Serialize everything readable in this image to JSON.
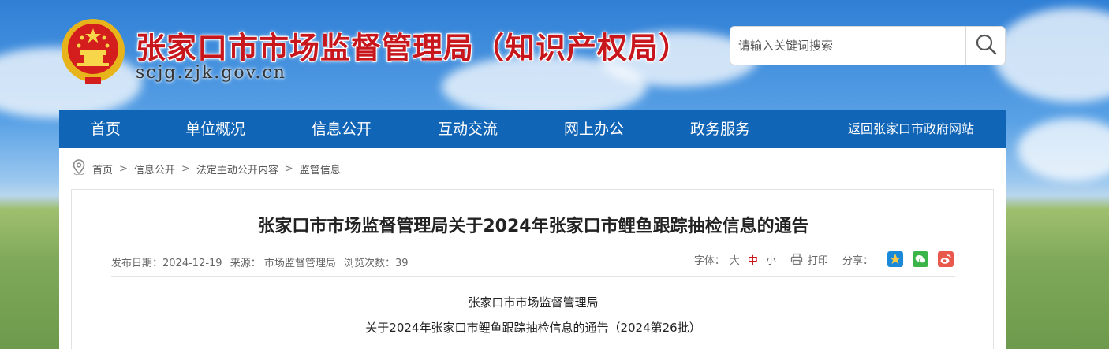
{
  "header": {
    "site_title": "张家口市市场监督管理局（知识产权局）",
    "site_domain": "scjg.zjk.gov.cn",
    "search_placeholder": "请输入关键词搜索"
  },
  "nav": {
    "items": [
      "首页",
      "单位概况",
      "信息公开",
      "互动交流",
      "网上办公",
      "政务服务"
    ],
    "back_link": "返回张家口市政府网站"
  },
  "breadcrumb": [
    "首页",
    "信息公开",
    "法定主动公开内容",
    "监管信息"
  ],
  "breadcrumb_sep": ">",
  "article": {
    "title": "张家口市市场监督管理局关于2024年张家口市鲤鱼跟踪抽检信息的通告",
    "meta": {
      "date": "发布日期：2024-12-19",
      "source": "来源： 市场监督管理局",
      "views": "浏览次数：39"
    },
    "tools": {
      "font_label": "字体：",
      "font_large": "大",
      "font_medium": "中",
      "font_small": "小",
      "print": "打印",
      "share_label": "分享："
    },
    "body": [
      "张家口市市场监督管理局",
      "关于2024年张家口市鲤鱼跟踪抽检信息的通告（2024第26批）"
    ]
  },
  "colors": {
    "brand_red": "#c8161d",
    "nav_blue": "#1165b6",
    "qzone": "#1a8ad8",
    "wechat": "#3bb44a",
    "weibo": "#e8584b"
  },
  "icons": [
    "emblem-icon",
    "search-icon",
    "location-pin-icon",
    "print-icon",
    "qzone-share-icon",
    "wechat-share-icon",
    "weibo-share-icon"
  ]
}
